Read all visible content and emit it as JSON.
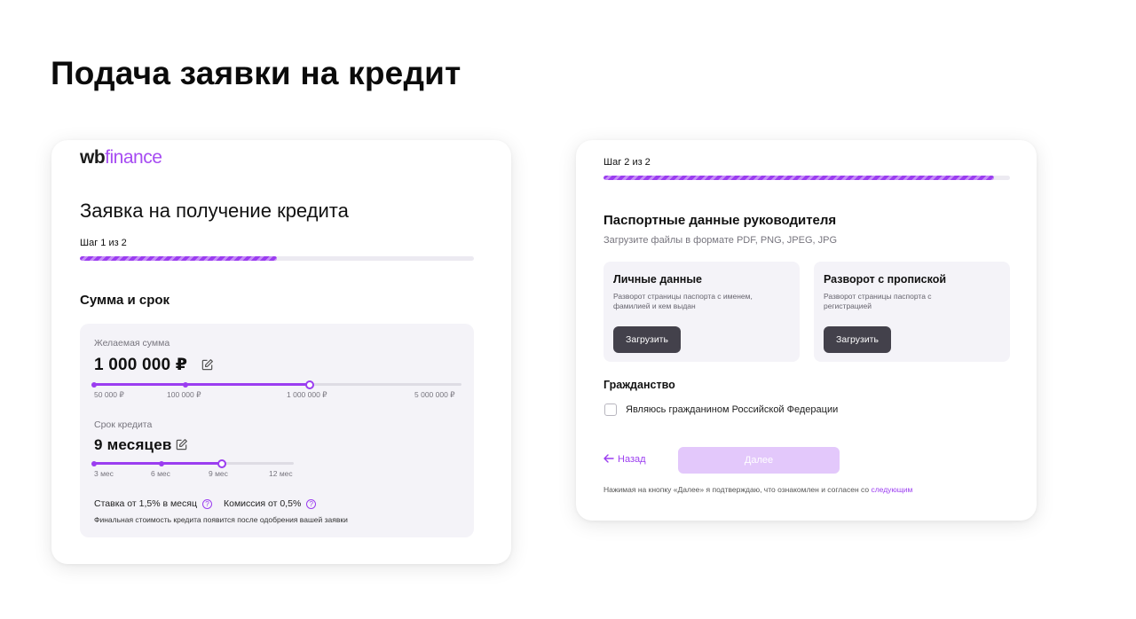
{
  "page_title": "Подача заявки на кредит",
  "colors": {
    "accent": "#9b3df0",
    "button_dark": "#43414b",
    "button_disabled": "#e3c8fb",
    "panel_bg": "#f4f3f8"
  },
  "left_card": {
    "logo": {
      "wb": "wb",
      "finance": "finance"
    },
    "title": "Заявка на получение кредита",
    "step_label": "Шаг 1 из 2",
    "progress": 0.5,
    "section_title": "Сумма и срок",
    "amount": {
      "label": "Желаемая сумма",
      "value": "1 000 000 ₽",
      "edit_icon": "edit-icon",
      "ticks": [
        "50 000 ₽",
        "100 000 ₽",
        "1 000 000 ₽",
        "5 000 000 ₽"
      ]
    },
    "term": {
      "label": "Срок кредита",
      "value": "9 месяцев",
      "edit_icon": "edit-icon",
      "ticks": [
        "3 мес",
        "6 мес",
        "9 мес",
        "12 мес"
      ]
    },
    "rate_text": "Ставка от 1,5% в месяц",
    "commission_text": "Комиссия от 0,5%",
    "help_icon": "question-icon",
    "fine_print": "Финальная стоимость кредита появится после одобрения вашей заявки"
  },
  "right_card": {
    "step_label": "Шаг 2 из 2",
    "progress": 1.0,
    "heading": "Паспортные данные руководителя",
    "subheading": "Загрузите файлы в формате PDF, PNG, JPEG, JPG",
    "uploads": [
      {
        "title": "Личные данные",
        "desc": "Разворот страницы паспорта с именем, фамилией и кем выдан",
        "button": "Загрузить"
      },
      {
        "title": "Разворот с пропиской",
        "desc": "Разворот страницы паспорта  с регистрацией",
        "button": "Загрузить"
      }
    ],
    "citizenship_title": "Гражданство",
    "citizenship_checkbox": "Являюсь гражданином Российской Федерации",
    "back_label": "Назад",
    "back_icon": "arrow-left-icon",
    "next_label": "Далее",
    "consent_text": "Нажимая на кнопку «Далее» я подтверждаю, что ознакомлен и согласен со ",
    "consent_link": "следующим"
  }
}
